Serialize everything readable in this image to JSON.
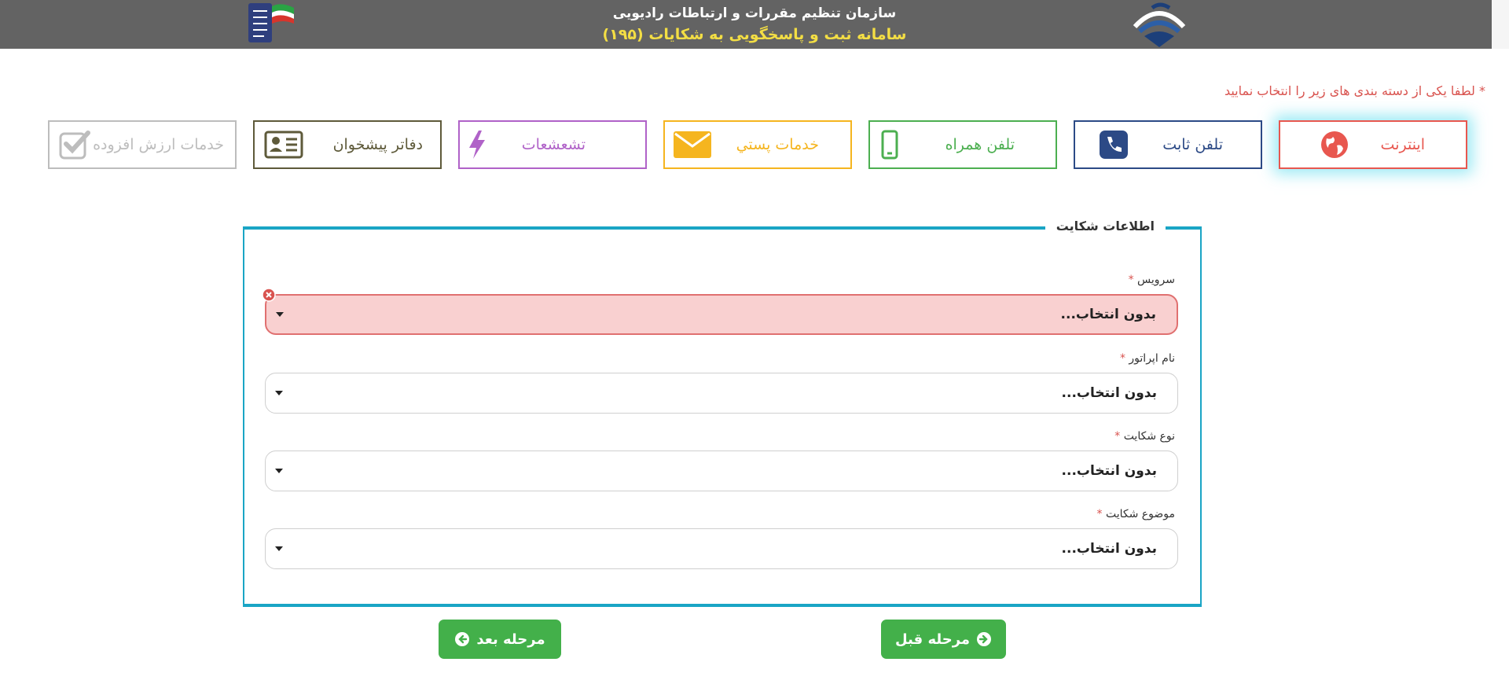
{
  "header": {
    "org_title": "سازمان تنظیم مقررات و ارتباطات رادیویی",
    "system_title": "سامانه ثبت و پاسخگویی به شکایات (۱۹۵)"
  },
  "instruction": {
    "asterisk": "*",
    "text": "لطفا یکی از دسته بندی های زیر را انتخاب نمایید"
  },
  "categories": [
    {
      "label": "اینترنت",
      "icon": "globe-icon",
      "color": "#e8574f",
      "active": true
    },
    {
      "label": "تلفن ثابت",
      "icon": "phone-icon",
      "color": "#2c4a86",
      "active": false
    },
    {
      "label": "تلفن همراه",
      "icon": "mobile-icon",
      "color": "#4caf50",
      "active": false
    },
    {
      "label": "خدمات پستي",
      "icon": "envelope-icon",
      "color": "#f5b51f",
      "active": false
    },
    {
      "label": "تشعشعات",
      "icon": "lightning-icon",
      "color": "#b062c8",
      "active": false
    },
    {
      "label": "دفاتر پيشخوان",
      "icon": "id-card-icon",
      "color": "#5e5a3a",
      "active": false
    },
    {
      "label": "خدمات ارزش افزوده",
      "icon": "checkbox-icon",
      "color": "#bdbdbd",
      "active": false
    }
  ],
  "panel": {
    "title": "اطلاعات شکایت",
    "fields": [
      {
        "label": "سرویس",
        "required": "*",
        "value": "بدون انتخاب...",
        "error": true
      },
      {
        "label": "نام اپراتور",
        "required": "*",
        "value": "بدون انتخاب...",
        "error": false
      },
      {
        "label": "نوع شکایت",
        "required": "*",
        "value": "بدون انتخاب...",
        "error": false
      },
      {
        "label": "موضوع شکایت",
        "required": "*",
        "value": "بدون انتخاب...",
        "error": false
      }
    ]
  },
  "buttons": {
    "prev_label": "مرحله قبل",
    "next_label": "مرحله بعد"
  },
  "colors": {
    "header_bg": "#636363",
    "header_accent": "#f3de44",
    "panel_border": "#1aa5c5",
    "button_green": "#43b04a",
    "error_red": "#d9534f"
  }
}
